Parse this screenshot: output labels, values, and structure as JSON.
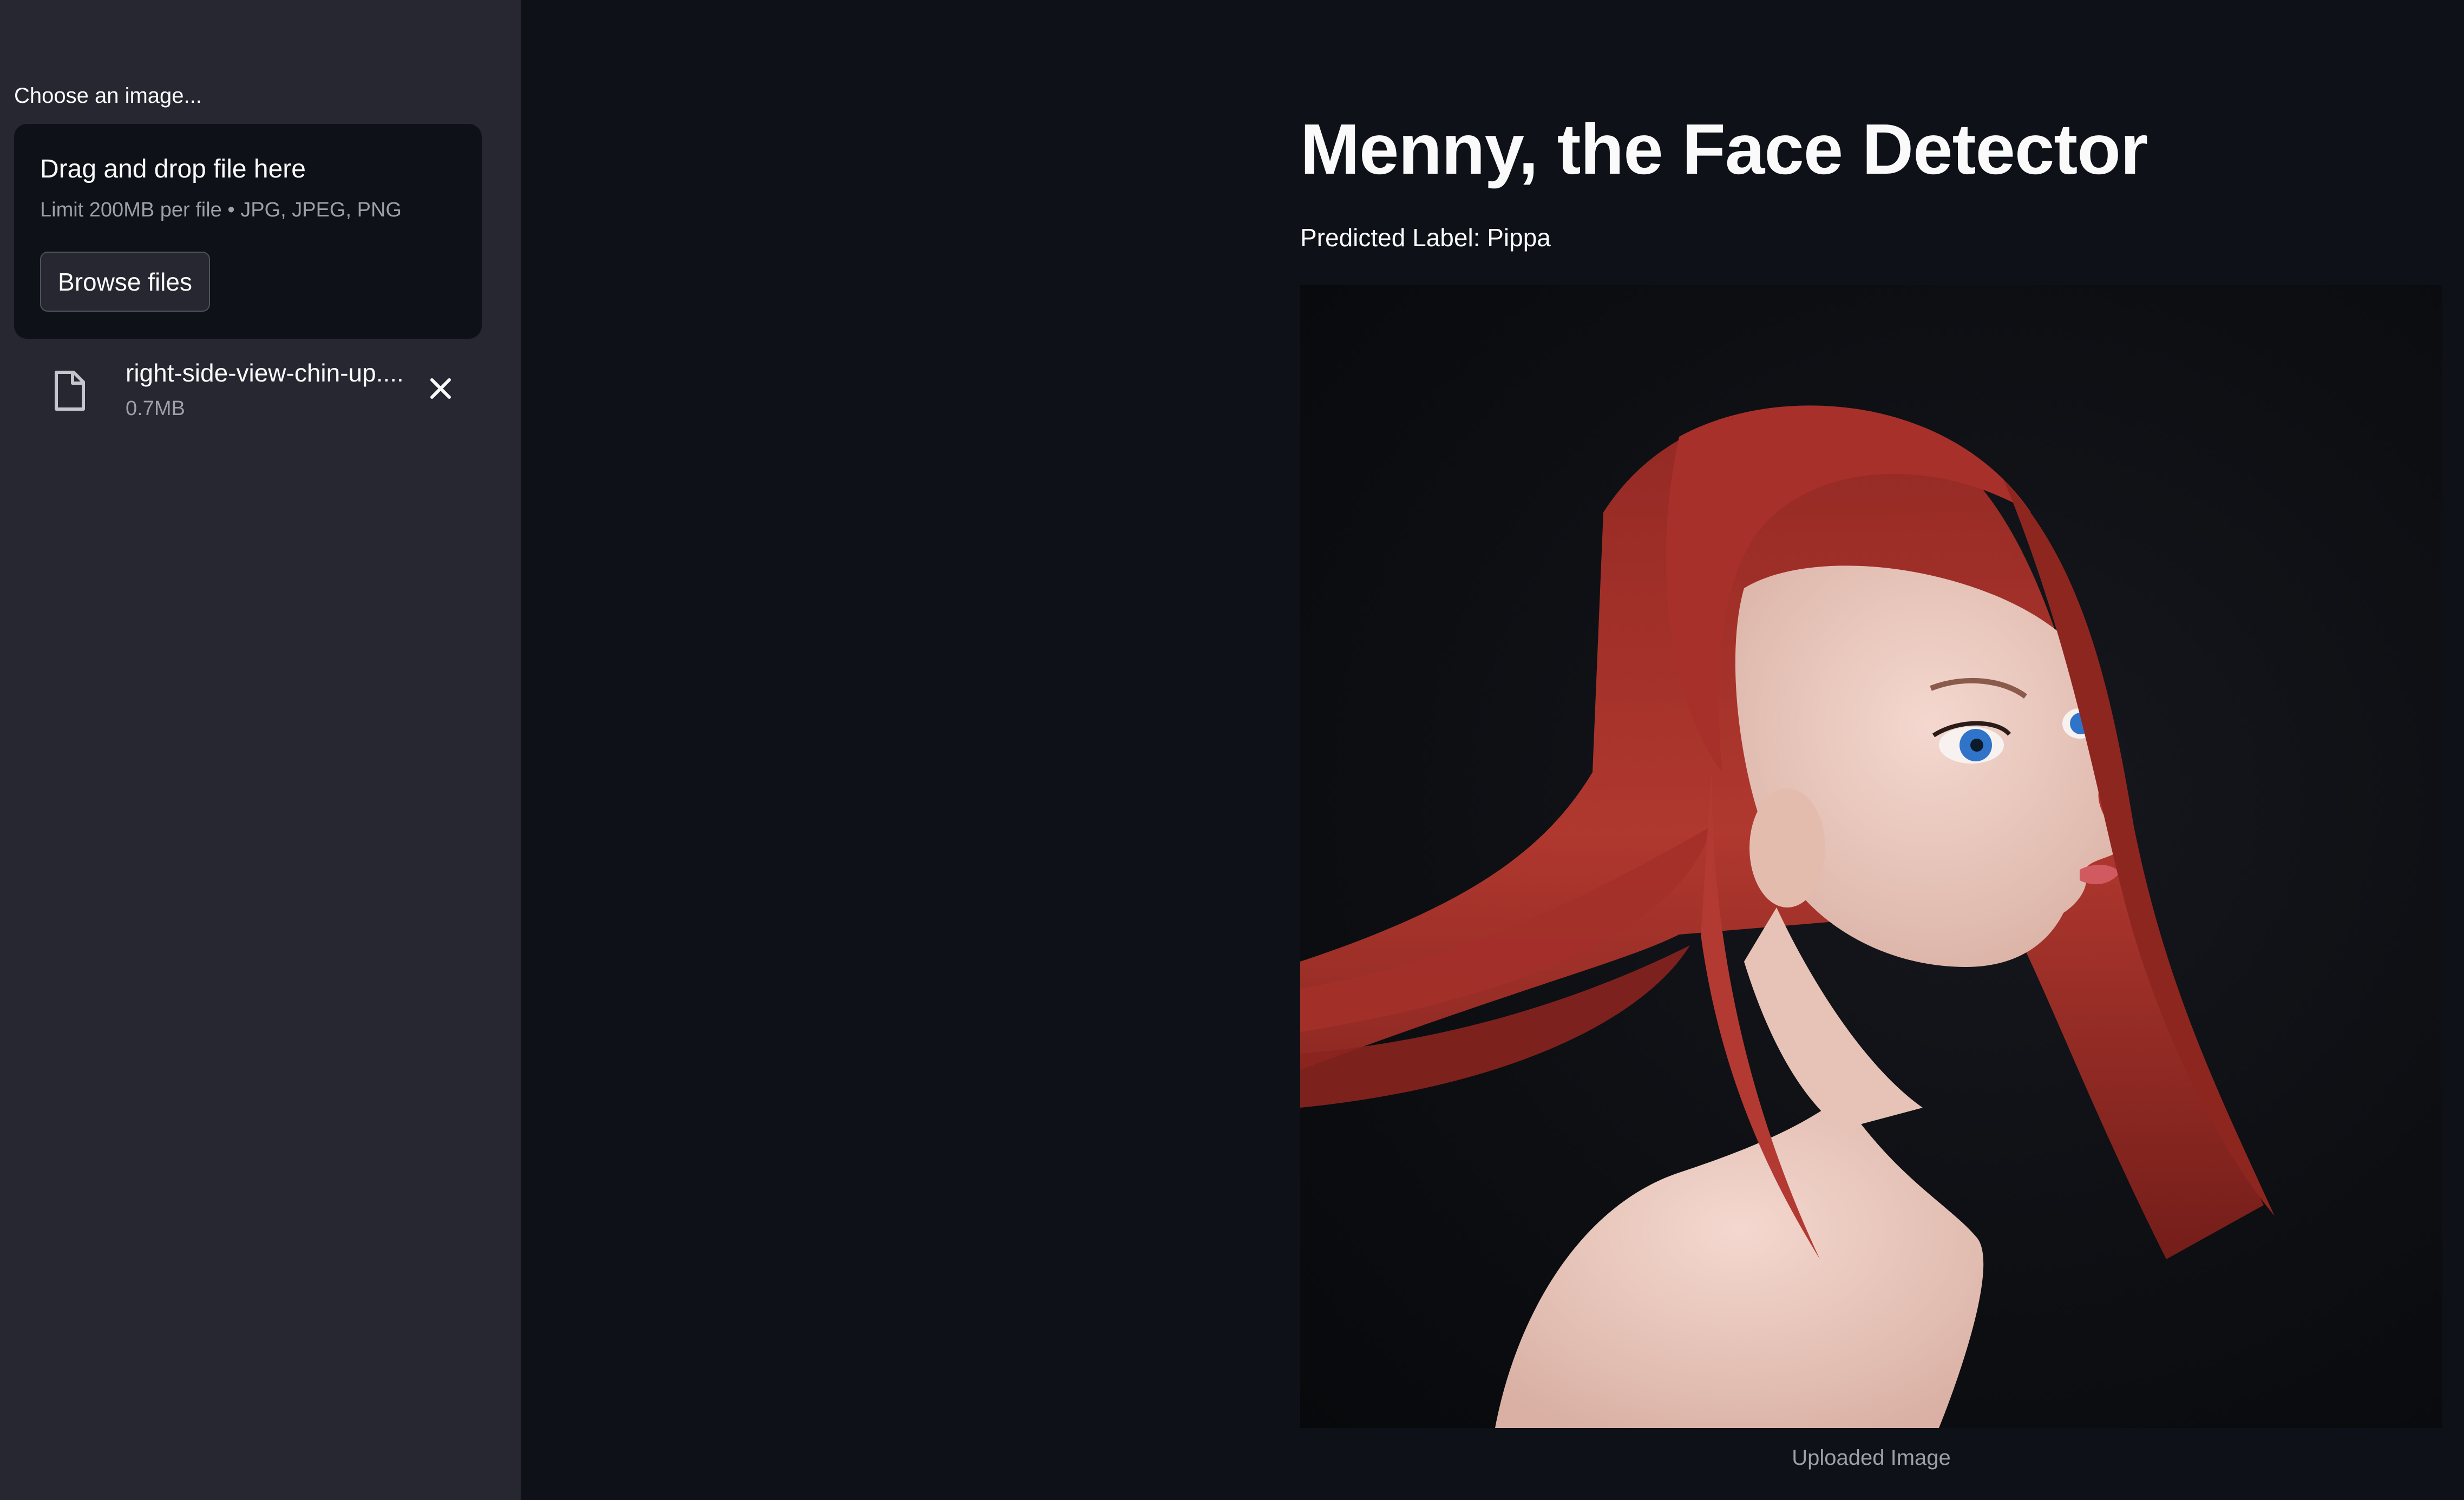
{
  "sidebar": {
    "uploader_label": "Choose an image...",
    "dropzone": {
      "title": "Drag and drop file here",
      "limit": "Limit 200MB per file • JPG, JPEG, PNG",
      "browse_label": "Browse files"
    },
    "file": {
      "name": "right-side-view-chin-up....",
      "size": "0.7MB"
    }
  },
  "main": {
    "title": "Menny, the Face Detector",
    "predicted_label_prefix": "Predicted Label: ",
    "predicted_label_value": "Pippa",
    "image_caption": "Uploaded Image"
  },
  "colors": {
    "app_background": "#0e1117",
    "sidebar_background": "#262730",
    "secondary_text": "#9ea0a9"
  }
}
